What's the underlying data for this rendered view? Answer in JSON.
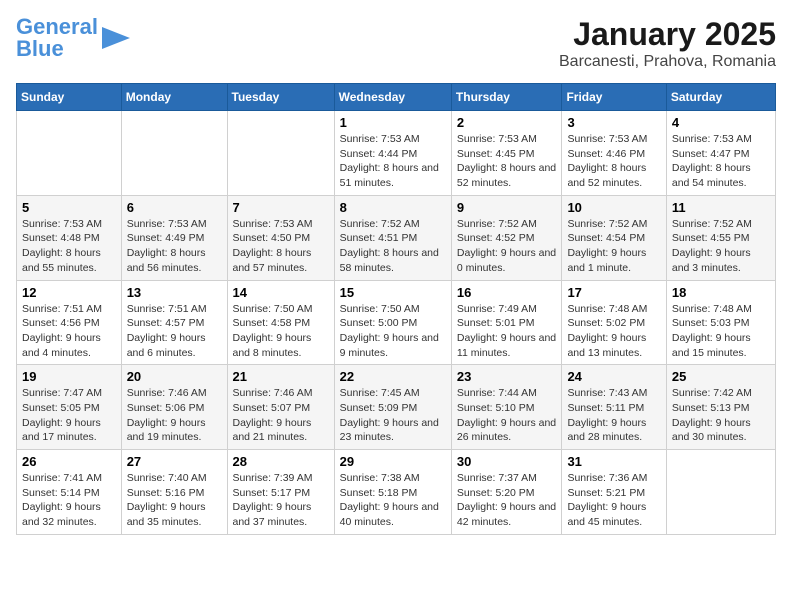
{
  "logo": {
    "text1": "General",
    "text2": "Blue"
  },
  "title": "January 2025",
  "subtitle": "Barcanesti, Prahova, Romania",
  "days_of_week": [
    "Sunday",
    "Monday",
    "Tuesday",
    "Wednesday",
    "Thursday",
    "Friday",
    "Saturday"
  ],
  "weeks": [
    [
      {
        "day": "",
        "info": ""
      },
      {
        "day": "",
        "info": ""
      },
      {
        "day": "",
        "info": ""
      },
      {
        "day": "1",
        "info": "Sunrise: 7:53 AM\nSunset: 4:44 PM\nDaylight: 8 hours and 51 minutes."
      },
      {
        "day": "2",
        "info": "Sunrise: 7:53 AM\nSunset: 4:45 PM\nDaylight: 8 hours and 52 minutes."
      },
      {
        "day": "3",
        "info": "Sunrise: 7:53 AM\nSunset: 4:46 PM\nDaylight: 8 hours and 52 minutes."
      },
      {
        "day": "4",
        "info": "Sunrise: 7:53 AM\nSunset: 4:47 PM\nDaylight: 8 hours and 54 minutes."
      }
    ],
    [
      {
        "day": "5",
        "info": "Sunrise: 7:53 AM\nSunset: 4:48 PM\nDaylight: 8 hours and 55 minutes."
      },
      {
        "day": "6",
        "info": "Sunrise: 7:53 AM\nSunset: 4:49 PM\nDaylight: 8 hours and 56 minutes."
      },
      {
        "day": "7",
        "info": "Sunrise: 7:53 AM\nSunset: 4:50 PM\nDaylight: 8 hours and 57 minutes."
      },
      {
        "day": "8",
        "info": "Sunrise: 7:52 AM\nSunset: 4:51 PM\nDaylight: 8 hours and 58 minutes."
      },
      {
        "day": "9",
        "info": "Sunrise: 7:52 AM\nSunset: 4:52 PM\nDaylight: 9 hours and 0 minutes."
      },
      {
        "day": "10",
        "info": "Sunrise: 7:52 AM\nSunset: 4:54 PM\nDaylight: 9 hours and 1 minute."
      },
      {
        "day": "11",
        "info": "Sunrise: 7:52 AM\nSunset: 4:55 PM\nDaylight: 9 hours and 3 minutes."
      }
    ],
    [
      {
        "day": "12",
        "info": "Sunrise: 7:51 AM\nSunset: 4:56 PM\nDaylight: 9 hours and 4 minutes."
      },
      {
        "day": "13",
        "info": "Sunrise: 7:51 AM\nSunset: 4:57 PM\nDaylight: 9 hours and 6 minutes."
      },
      {
        "day": "14",
        "info": "Sunrise: 7:50 AM\nSunset: 4:58 PM\nDaylight: 9 hours and 8 minutes."
      },
      {
        "day": "15",
        "info": "Sunrise: 7:50 AM\nSunset: 5:00 PM\nDaylight: 9 hours and 9 minutes."
      },
      {
        "day": "16",
        "info": "Sunrise: 7:49 AM\nSunset: 5:01 PM\nDaylight: 9 hours and 11 minutes."
      },
      {
        "day": "17",
        "info": "Sunrise: 7:48 AM\nSunset: 5:02 PM\nDaylight: 9 hours and 13 minutes."
      },
      {
        "day": "18",
        "info": "Sunrise: 7:48 AM\nSunset: 5:03 PM\nDaylight: 9 hours and 15 minutes."
      }
    ],
    [
      {
        "day": "19",
        "info": "Sunrise: 7:47 AM\nSunset: 5:05 PM\nDaylight: 9 hours and 17 minutes."
      },
      {
        "day": "20",
        "info": "Sunrise: 7:46 AM\nSunset: 5:06 PM\nDaylight: 9 hours and 19 minutes."
      },
      {
        "day": "21",
        "info": "Sunrise: 7:46 AM\nSunset: 5:07 PM\nDaylight: 9 hours and 21 minutes."
      },
      {
        "day": "22",
        "info": "Sunrise: 7:45 AM\nSunset: 5:09 PM\nDaylight: 9 hours and 23 minutes."
      },
      {
        "day": "23",
        "info": "Sunrise: 7:44 AM\nSunset: 5:10 PM\nDaylight: 9 hours and 26 minutes."
      },
      {
        "day": "24",
        "info": "Sunrise: 7:43 AM\nSunset: 5:11 PM\nDaylight: 9 hours and 28 minutes."
      },
      {
        "day": "25",
        "info": "Sunrise: 7:42 AM\nSunset: 5:13 PM\nDaylight: 9 hours and 30 minutes."
      }
    ],
    [
      {
        "day": "26",
        "info": "Sunrise: 7:41 AM\nSunset: 5:14 PM\nDaylight: 9 hours and 32 minutes."
      },
      {
        "day": "27",
        "info": "Sunrise: 7:40 AM\nSunset: 5:16 PM\nDaylight: 9 hours and 35 minutes."
      },
      {
        "day": "28",
        "info": "Sunrise: 7:39 AM\nSunset: 5:17 PM\nDaylight: 9 hours and 37 minutes."
      },
      {
        "day": "29",
        "info": "Sunrise: 7:38 AM\nSunset: 5:18 PM\nDaylight: 9 hours and 40 minutes."
      },
      {
        "day": "30",
        "info": "Sunrise: 7:37 AM\nSunset: 5:20 PM\nDaylight: 9 hours and 42 minutes."
      },
      {
        "day": "31",
        "info": "Sunrise: 7:36 AM\nSunset: 5:21 PM\nDaylight: 9 hours and 45 minutes."
      },
      {
        "day": "",
        "info": ""
      }
    ]
  ]
}
